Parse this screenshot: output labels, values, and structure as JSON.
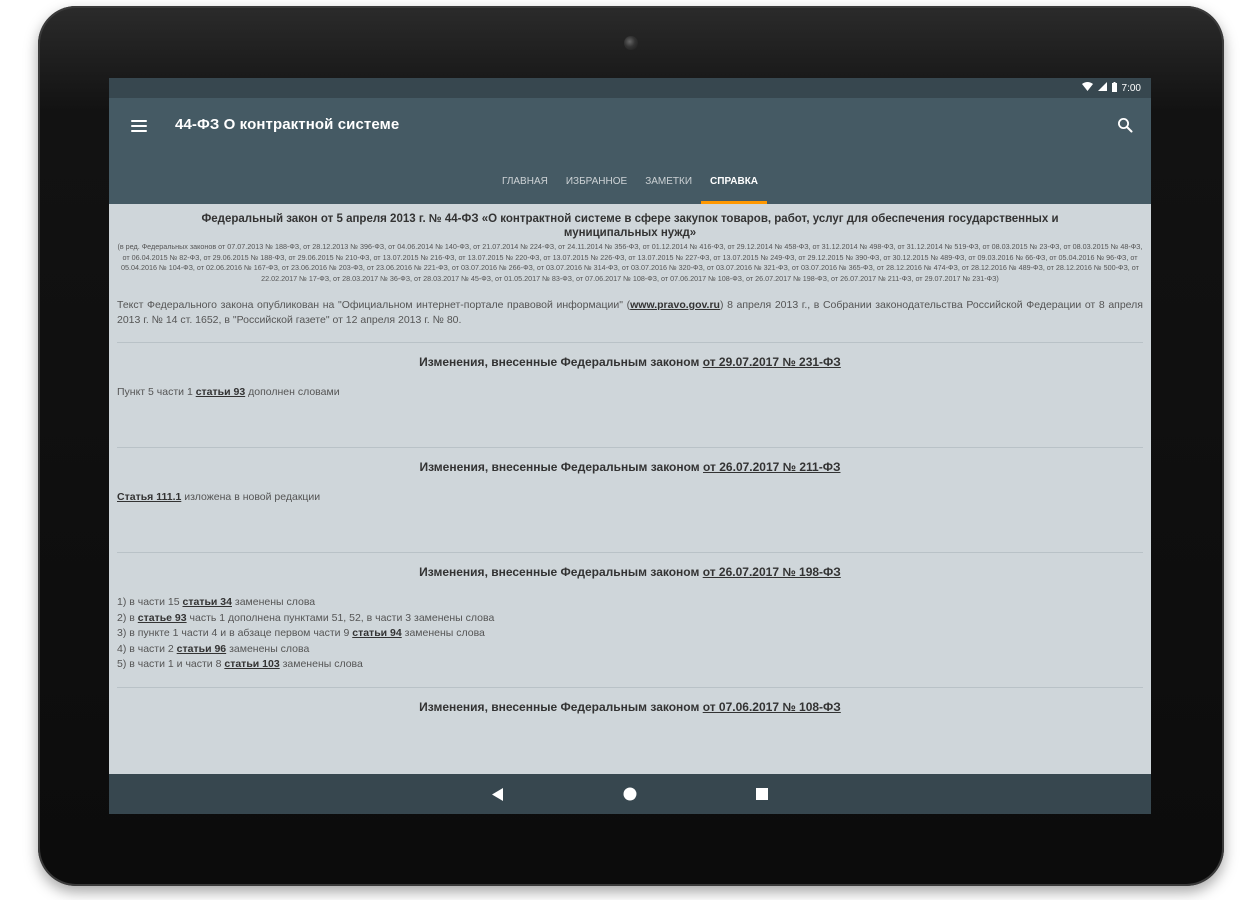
{
  "statusbar": {
    "time": "7:00",
    "wifi_icon": "wifi-icon",
    "signal_icon": "signal-icon",
    "battery_icon": "battery-icon"
  },
  "appbar": {
    "title": "44-ФЗ О контрактной системе",
    "menu_icon": "menu-icon",
    "search_icon": "search-icon"
  },
  "tabs": [
    {
      "label": "Главная"
    },
    {
      "label": "Избранное"
    },
    {
      "label": "Заметки"
    },
    {
      "label": "Справка",
      "active": true
    }
  ],
  "colors": {
    "appbar": "#455a64",
    "statusbar": "#37474f",
    "tab_indicator": "#ff9800",
    "content_bg": "#cfd6da"
  },
  "content": {
    "law_title": "Федеральный закон от 5 апреля 2013 г. № 44-ФЗ «О контрактной системе в сфере закупок товаров, работ, услуг для обеспечения государственных и муниципальных нужд»",
    "law_editions": "(в ред. Федеральных законов от 07.07.2013 № 188-ФЗ, от 28.12.2013 № 396-ФЗ, от 04.06.2014 № 140-ФЗ, от 21.07.2014 № 224-ФЗ, от 24.11.2014 № 356-ФЗ, от 01.12.2014 № 416-ФЗ, от 29.12.2014 № 458-ФЗ, от 31.12.2014 № 498-ФЗ, от 31.12.2014 № 519-ФЗ, от 08.03.2015 № 23-ФЗ, от 08.03.2015 № 48-ФЗ, от 06.04.2015 № 82-ФЗ, от 29.06.2015 № 188-ФЗ, от 29.06.2015 № 210-ФЗ, от 13.07.2015 № 216-ФЗ, от 13.07.2015 № 220-ФЗ, от 13.07.2015 № 226-ФЗ, от 13.07.2015 № 227-ФЗ, от 13.07.2015 № 249-ФЗ, от 29.12.2015 № 390-ФЗ, от 30.12.2015 № 489-ФЗ, от 09.03.2016 № 66-ФЗ, от 05.04.2016 № 96-ФЗ, от 05.04.2016 № 104-ФЗ, от 02.06.2016 № 167-ФЗ, от 23.06.2016 № 203-ФЗ, от 23.06.2016 № 221-ФЗ, от 03.07.2016 № 266-ФЗ, от 03.07.2016 № 314-ФЗ, от 03.07.2016 № 320-ФЗ, от 03.07.2016 № 321-ФЗ, от 03.07.2016 № 365-ФЗ, от 28.12.2016 № 474-ФЗ, от 28.12.2016 № 489-ФЗ, от 28.12.2016 № 500-ФЗ, от 22.02.2017 № 17-ФЗ, от 28.03.2017 № 36-ФЗ, от 28.03.2017 № 45-ФЗ, от 01.05.2017 № 83-ФЗ, от 07.06.2017 № 108-ФЗ, от 07.06.2017 № 108-ФЗ, от 26.07.2017 № 198-ФЗ, от 26.07.2017 № 211-ФЗ, от 29.07.2017 № 231-ФЗ)",
    "published_before": "Текст Федерального закона опубликован на \"Официальном интернет-портале правовой информации\" (",
    "published_link": "www.pravo.gov.ru",
    "published_after": ") 8 апреля 2013 г., в Собрании законодательства Российской Федерации от 8 апреля 2013 г. № 14 ст. 1652, в \"Российской газете\" от 12 апреля 2013 г. № 80.",
    "changes": [
      {
        "heading_prefix": "Изменения, внесенные Федеральным законом ",
        "heading_link": "от 29.07.2017 № 231-ФЗ",
        "lines": [
          {
            "before": "Пункт 5 части 1 ",
            "link": "статьи 93",
            "after": " дополнен словами"
          }
        ]
      },
      {
        "heading_prefix": "Изменения, внесенные Федеральным законом ",
        "heading_link": "от 26.07.2017 № 211-ФЗ",
        "lines": [
          {
            "before": "",
            "link": "Статья 111.1",
            "after": " изложена в новой редакции"
          }
        ]
      },
      {
        "heading_prefix": "Изменения, внесенные Федеральным законом ",
        "heading_link": "от 26.07.2017 № 198-ФЗ",
        "lines": [
          {
            "before": "1) в части 15 ",
            "link": "статьи 34",
            "after": " заменены слова"
          },
          {
            "before": "2) в ",
            "link": "статье 93",
            "after": " часть 1 дополнена пунктами 51, 52, в части 3 заменены слова"
          },
          {
            "before": "3) в пункте 1 части 4 и в абзаце первом части 9 ",
            "link": "статьи 94",
            "after": " заменены слова"
          },
          {
            "before": "4) в части 2 ",
            "link": "статьи 96",
            "after": " заменены слова"
          },
          {
            "before": "5) в части 1 и части 8 ",
            "link": "статьи 103",
            "after": " заменены слова"
          }
        ]
      },
      {
        "heading_prefix": "Изменения, внесенные Федеральным законом ",
        "heading_link": "от 07.06.2017 № 108-ФЗ",
        "lines": []
      }
    ]
  },
  "navbar": {
    "back_icon": "back-icon",
    "home_icon": "home-icon",
    "recents_icon": "recents-icon"
  }
}
